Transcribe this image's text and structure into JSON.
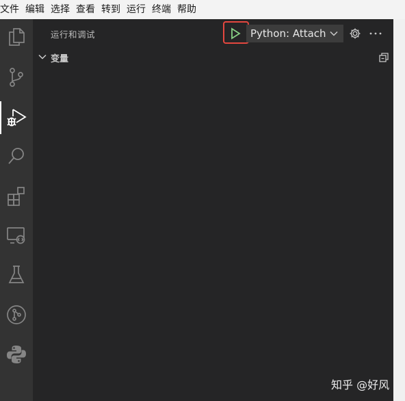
{
  "menubar": {
    "items": [
      {
        "label": "文件"
      },
      {
        "label": "编辑"
      },
      {
        "label": "选择"
      },
      {
        "label": "查看"
      },
      {
        "label": "转到"
      },
      {
        "label": "运行"
      },
      {
        "label": "终端"
      },
      {
        "label": "帮助"
      }
    ]
  },
  "activitybar": {
    "icons": [
      {
        "name": "explorer-icon"
      },
      {
        "name": "source-control-icon"
      },
      {
        "name": "run-debug-icon",
        "active": true
      },
      {
        "name": "search-icon"
      },
      {
        "name": "extensions-icon"
      },
      {
        "name": "remote-explorer-icon"
      },
      {
        "name": "testing-icon"
      },
      {
        "name": "git-graph-icon"
      },
      {
        "name": "python-icon"
      }
    ]
  },
  "sidebar": {
    "title": "运行和调试",
    "config_select": {
      "value": "Python: Attach"
    },
    "sections": [
      {
        "title": "变量",
        "expanded": true
      }
    ]
  },
  "watermark": "知乎 @好风",
  "colors": {
    "highlight_border": "#e5473f",
    "run_icon": "#89d185",
    "sidebar_bg": "#252526",
    "activitybar_bg": "#333333"
  }
}
